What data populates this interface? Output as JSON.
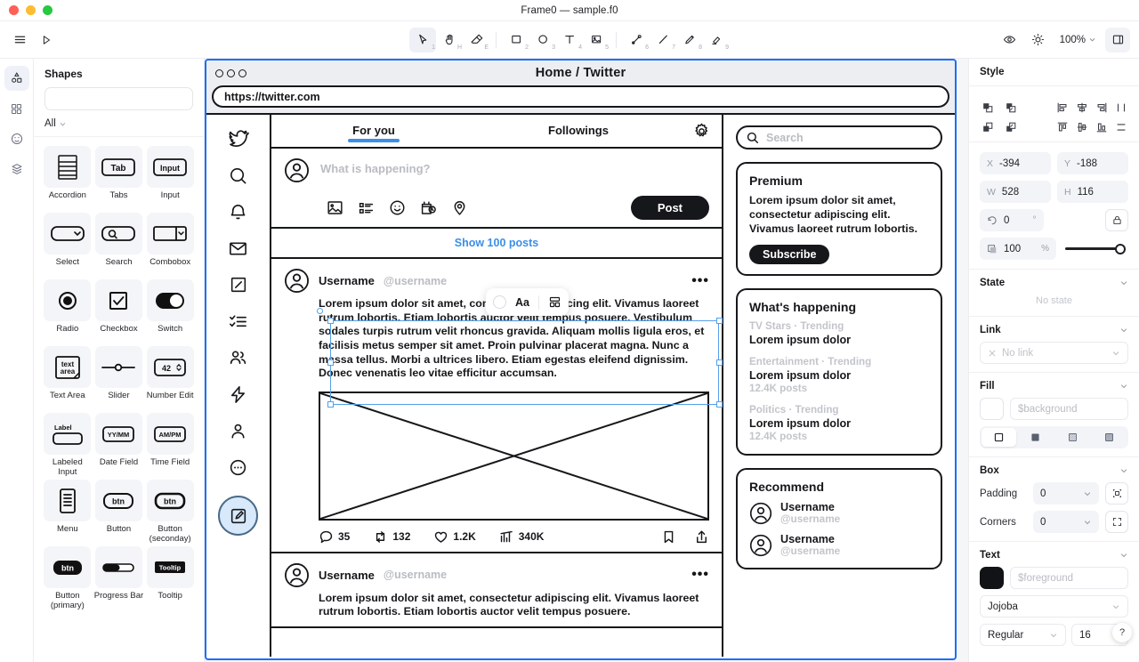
{
  "window": {
    "title": "Frame0 — sample.f0"
  },
  "toolbar": {
    "menu_icon": "hamburger-icon",
    "play_icon": "play-icon",
    "tools": [
      {
        "name": "select-tool",
        "icon": "cursor-icon",
        "kbd": "1",
        "active": true
      },
      {
        "name": "hand-tool",
        "icon": "hand-icon",
        "kbd": "H",
        "active": false
      },
      {
        "name": "eraser-tool",
        "icon": "eraser-icon",
        "kbd": "E",
        "active": false
      },
      {
        "name": "rectangle-tool",
        "icon": "square-icon",
        "kbd": "2",
        "active": false
      },
      {
        "name": "ellipse-tool",
        "icon": "circle-icon",
        "kbd": "3",
        "active": false
      },
      {
        "name": "text-tool",
        "icon": "text-icon",
        "kbd": "4",
        "active": false
      },
      {
        "name": "image-tool",
        "icon": "image-icon",
        "kbd": "5",
        "active": false
      },
      {
        "name": "connector-tool",
        "icon": "connector-icon",
        "kbd": "6",
        "active": false
      },
      {
        "name": "line-tool",
        "icon": "line-icon",
        "kbd": "7",
        "active": false
      },
      {
        "name": "pencil-tool",
        "icon": "pencil-icon",
        "kbd": "8",
        "active": false
      },
      {
        "name": "highlighter-tool",
        "icon": "highlighter-icon",
        "kbd": "9",
        "active": false
      }
    ],
    "eye_icon": "eye-icon",
    "theme_icon": "sun-icon",
    "zoom_level": "100%",
    "panel_icon": "right-panel-icon"
  },
  "rail": {
    "items": [
      {
        "name": "sidebar-item-shapes",
        "icon": "shapes-icon",
        "active": true
      },
      {
        "name": "sidebar-item-library",
        "icon": "grid-icon",
        "active": false
      },
      {
        "name": "sidebar-item-icons",
        "icon": "smiley-icon",
        "active": false
      },
      {
        "name": "sidebar-item-layers",
        "icon": "layers-icon",
        "active": false
      }
    ]
  },
  "shapes_panel": {
    "title": "Shapes",
    "search_placeholder": "",
    "search_value": "",
    "search_icon": "search-icon",
    "clear_icon": "close-icon",
    "filter_label": "All",
    "filter_icon": "chevron-down-icon",
    "items": [
      {
        "label": "Accordion",
        "icon": "accordion-shape"
      },
      {
        "label": "Tabs",
        "icon": "tabs-shape",
        "glyph": "Tab"
      },
      {
        "label": "Input",
        "icon": "input-shape",
        "glyph": "Input"
      },
      {
        "label": "Select",
        "icon": "select-shape"
      },
      {
        "label": "Search",
        "icon": "search-shape"
      },
      {
        "label": "Combobox",
        "icon": "combobox-shape"
      },
      {
        "label": "Radio",
        "icon": "radio-shape"
      },
      {
        "label": "Checkbox",
        "icon": "checkbox-shape"
      },
      {
        "label": "Switch",
        "icon": "switch-shape"
      },
      {
        "label": "Text Area",
        "icon": "textarea-shape",
        "glyph": "text area"
      },
      {
        "label": "Slider",
        "icon": "slider-shape"
      },
      {
        "label": "Number Edit",
        "icon": "number-edit-shape",
        "glyph": "42"
      },
      {
        "label": "Labeled Input",
        "icon": "labeled-input-shape",
        "glyph": "Label"
      },
      {
        "label": "Date Field",
        "icon": "date-field-shape",
        "glyph": "YY/MM"
      },
      {
        "label": "Time Field",
        "icon": "time-field-shape",
        "glyph": "AM/PM"
      },
      {
        "label": "Menu",
        "icon": "menu-shape"
      },
      {
        "label": "Button",
        "icon": "button-shape",
        "glyph": "btn"
      },
      {
        "label": "Button (seconday)",
        "icon": "button-secondary-shape",
        "glyph": "btn"
      },
      {
        "label": "Button (primary)",
        "icon": "button-primary-shape",
        "glyph": "btn"
      },
      {
        "label": "Progress Bar",
        "icon": "progress-bar-shape"
      },
      {
        "label": "Tooltip",
        "icon": "tooltip-shape",
        "glyph": "Tooltip"
      }
    ]
  },
  "canvas": {
    "mini_toolbar": {
      "color_swatch": "color-swatch-icon",
      "font_label": "Aa",
      "layout_icon": "layout-icon"
    },
    "wireframe": {
      "browser_title": "Home / Twitter",
      "url": "https://twitter.com",
      "nav_icons": [
        "twitter-bird-icon",
        "search-icon",
        "bell-icon",
        "mail-icon",
        "grok-icon",
        "lists-icon",
        "communities-icon",
        "premium-bolt-icon",
        "profile-icon",
        "more-icon"
      ],
      "compose_icon": "compose-icon",
      "tabs": [
        {
          "label": "For you",
          "active": true
        },
        {
          "label": "Followings",
          "active": false
        }
      ],
      "settings_icon": "gear-icon",
      "composer": {
        "avatar": "avatar-icon",
        "placeholder": "What is happening?",
        "icons": [
          "image-icon",
          "poll-icon",
          "emoji-icon",
          "schedule-icon",
          "location-icon"
        ],
        "post_label": "Post"
      },
      "show_posts_label": "Show 100 posts",
      "posts": [
        {
          "username": "Username",
          "handle": "@username",
          "text": "Lorem ipsum dolor sit amet, consectetur adipiscing elit. Vivamus laoreet rutrum lobortis. Etiam lobortis auctor velit tempus posuere. Vestibulum sodales turpis rutrum velit rhoncus gravida. Aliquam mollis ligula eros, et facilisis metus semper sit amet. Proin pulvinar placerat magna. Nunc a massa tellus. Morbi a ultrices libero. Etiam egestas eleifend dignissim. Donec venenatis leo vitae efficitur accumsan.",
          "has_image": true,
          "stats": [
            {
              "name": "reply",
              "icon": "comment-icon",
              "value": "35"
            },
            {
              "name": "repost",
              "icon": "retweet-icon",
              "value": "132"
            },
            {
              "name": "like",
              "icon": "heart-icon",
              "value": "1.2K"
            },
            {
              "name": "views",
              "icon": "analytics-icon",
              "value": "340K"
            }
          ],
          "bookmark_icon": "bookmark-icon",
          "share_icon": "share-icon"
        },
        {
          "username": "Username",
          "handle": "@username",
          "text": "Lorem ipsum dolor sit amet, consectetur adipiscing elit. Vivamus laoreet rutrum lobortis. Etiam lobortis auctor velit tempus posuere.",
          "has_image": false
        }
      ],
      "search": {
        "placeholder": "Search",
        "icon": "search-icon"
      },
      "premium_card": {
        "title": "Premium",
        "body": "Lorem ipsum dolor sit amet, consectetur adipiscing elit. Vivamus laoreet rutrum lobortis.",
        "button": "Subscribe"
      },
      "happening_card": {
        "title": "What's happening",
        "trends": [
          {
            "category": "TV Stars · Trending",
            "name": "Lorem ipsum dolor",
            "count": ""
          },
          {
            "category": "Entertainment · Trending",
            "name": "Lorem ipsum dolor",
            "count": "12.4K posts"
          },
          {
            "category": "Politics · Trending",
            "name": "Lorem ipsum dolor",
            "count": "12.4K posts"
          }
        ]
      },
      "recommend_card": {
        "title": "Recommend",
        "users": [
          {
            "name": "Username",
            "handle": "@username"
          },
          {
            "name": "Username",
            "handle": "@username"
          }
        ]
      }
    }
  },
  "style_panel": {
    "style": {
      "title": "Style",
      "arrange_icons": [
        "bring-to-front-icon",
        "bring-forward-icon",
        "send-backward-icon",
        "send-to-back-icon"
      ],
      "align_icons": [
        "align-left-icon",
        "align-center-h-icon",
        "align-right-icon",
        "distribute-h-icon",
        "align-top-icon",
        "align-middle-v-icon",
        "align-bottom-icon",
        "distribute-v-icon"
      ],
      "x_label": "X",
      "x_value": "-394",
      "y_label": "Y",
      "y_value": "-188",
      "w_label": "W",
      "w_value": "528",
      "h_label": "H",
      "h_value": "116",
      "rotation_icon": "rotate-icon",
      "rotation_value": "0",
      "rotation_unit": "°",
      "lock_icon": "lock-icon",
      "opacity_icon": "opacity-icon",
      "opacity_value": "100",
      "opacity_unit": "%"
    },
    "state": {
      "title": "State",
      "empty_label": "No state"
    },
    "link": {
      "title": "Link",
      "clear_icon": "close-icon",
      "value": "No link",
      "chevron": "chevron-down-icon"
    },
    "fill": {
      "title": "Fill",
      "color_value": "$background",
      "color_hex": "#ffffff",
      "styles": [
        {
          "name": "fill-none",
          "on": true
        },
        {
          "name": "fill-solid",
          "on": false
        },
        {
          "name": "fill-hachure",
          "on": false
        },
        {
          "name": "fill-cross-hatch",
          "on": false
        }
      ]
    },
    "box": {
      "title": "Box",
      "padding_label": "Padding",
      "padding_value": "0",
      "padding_icon": "padding-icon",
      "corners_label": "Corners",
      "corners_value": "0",
      "corners_icon": "corners-icon"
    },
    "text": {
      "title": "Text",
      "color_value": "$foreground",
      "color_hex": "#111317",
      "font_family": "Jojoba",
      "font_weight": "Regular",
      "font_size": "16"
    },
    "help_label": "?"
  }
}
